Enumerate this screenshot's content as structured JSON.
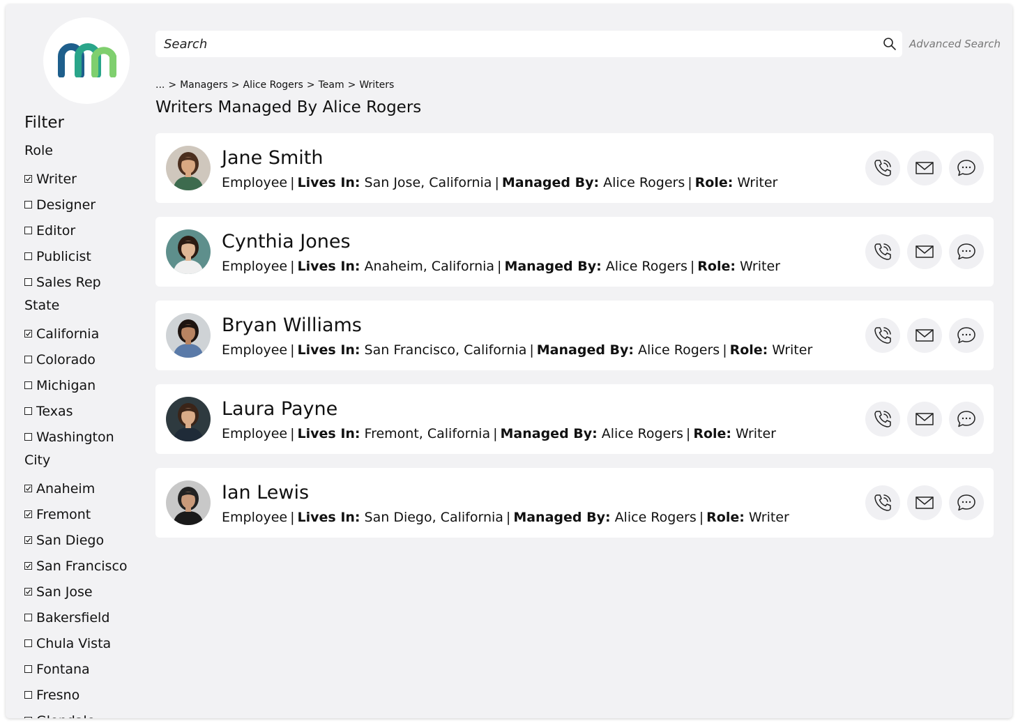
{
  "colors": {
    "frame_bg": "#f2f2f4",
    "card_bg": "#ffffff",
    "logo_blue": "#1e5f8c",
    "logo_teal": "#2aa58a",
    "logo_green": "#7fcf6e"
  },
  "search": {
    "placeholder": "Search",
    "advanced_label": "Advanced Search",
    "icon": "search-icon"
  },
  "breadcrumb": [
    {
      "label": "..."
    },
    {
      "label": ">"
    },
    {
      "label": "Managers"
    },
    {
      "label": ">"
    },
    {
      "label": "Alice Rogers"
    },
    {
      "label": ">"
    },
    {
      "label": "Team"
    },
    {
      "label": ">"
    },
    {
      "label": "Writers"
    }
  ],
  "page_title": "Writers Managed By Alice Rogers",
  "filter": {
    "title": "Filter",
    "sections": [
      {
        "heading": "Role",
        "items": [
          {
            "label": "Writer",
            "checked": true
          },
          {
            "label": "Designer",
            "checked": false
          },
          {
            "label": "Editor",
            "checked": false
          },
          {
            "label": "Publicist",
            "checked": false
          },
          {
            "label": "Sales Rep",
            "checked": false
          }
        ]
      },
      {
        "heading": "State",
        "items": [
          {
            "label": "California",
            "checked": true
          },
          {
            "label": "Colorado",
            "checked": false
          },
          {
            "label": "Michigan",
            "checked": false
          },
          {
            "label": "Texas",
            "checked": false
          },
          {
            "label": "Washington",
            "checked": false
          }
        ]
      },
      {
        "heading": "City",
        "items": [
          {
            "label": "Anaheim",
            "checked": true
          },
          {
            "label": "Fremont",
            "checked": true
          },
          {
            "label": "San Diego",
            "checked": true
          },
          {
            "label": "San Francisco",
            "checked": true
          },
          {
            "label": "San Jose",
            "checked": true
          },
          {
            "label": "Bakersfield",
            "checked": false
          },
          {
            "label": "Chula Vista",
            "checked": false
          },
          {
            "label": "Fontana",
            "checked": false
          },
          {
            "label": "Fresno",
            "checked": false
          },
          {
            "label": "Glendale",
            "checked": false
          }
        ]
      }
    ]
  },
  "labels": {
    "type": "Employee",
    "lives_in": "Lives In:",
    "managed_by": "Managed By:",
    "role": "Role:",
    "separator": "|"
  },
  "people": [
    {
      "name": "Jane Smith",
      "location": "San Jose, California",
      "manager": "Alice Rogers",
      "role": "Writer",
      "skin": "#d9a882",
      "hair": "#4a2e1e",
      "shirt": "#3d6b4e",
      "bg": "#cfc7bd"
    },
    {
      "name": "Cynthia Jones",
      "location": "Anaheim, California",
      "manager": "Alice Rogers",
      "role": "Writer",
      "skin": "#e0b796",
      "hair": "#2b1a12",
      "shirt": "#efefef",
      "bg": "#5e8f8c"
    },
    {
      "name": "Bryan Williams",
      "location": "San Francisco, California",
      "manager": "Alice Rogers",
      "role": "Writer",
      "skin": "#b98462",
      "hair": "#1e1410",
      "shirt": "#5a7aa8",
      "bg": "#cfd3d6"
    },
    {
      "name": "Laura Payne",
      "location": "Fremont, California",
      "manager": "Alice Rogers",
      "role": "Writer",
      "skin": "#d9ab88",
      "hair": "#3a2418",
      "shirt": "#1f2b38",
      "bg": "#2e3a3f"
    },
    {
      "name": "Ian Lewis",
      "location": "San Diego, California",
      "manager": "Alice Rogers",
      "role": "Writer",
      "skin": "#c99a7a",
      "hair": "#222222",
      "shirt": "#1a1a1a",
      "bg": "#c8c8c8"
    }
  ],
  "action_icons": [
    "phone-icon",
    "mail-icon",
    "chat-icon"
  ]
}
